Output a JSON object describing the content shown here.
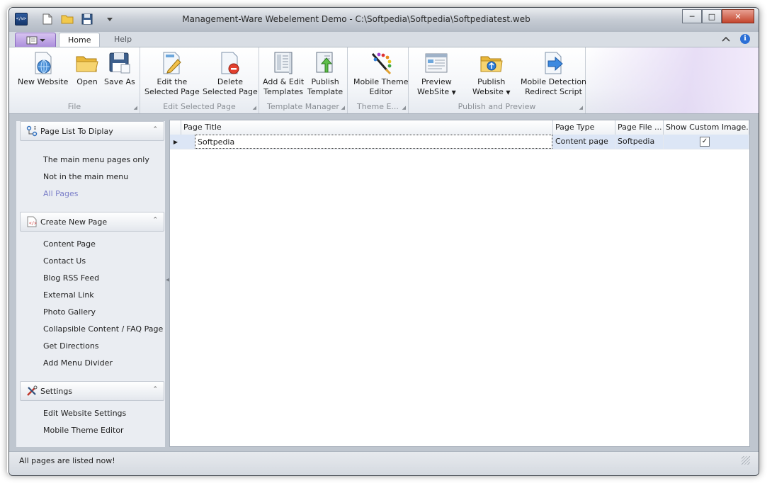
{
  "window": {
    "title": "Management-Ware Webelement Demo - C:\\Softpedia\\Softpedia\\Softpediatest.web",
    "app_icon_text": "</w>"
  },
  "tabs": [
    {
      "label": "Home",
      "active": true
    },
    {
      "label": "Help",
      "active": false
    }
  ],
  "ribbon": {
    "groups": [
      {
        "label": "File",
        "buttons": [
          {
            "line1": "New Website",
            "line2": "",
            "icon": "new-website-icon"
          },
          {
            "line1": "Open",
            "line2": "",
            "icon": "folder-open-icon"
          },
          {
            "line1": "Save As",
            "line2": "",
            "icon": "save-as-icon"
          }
        ]
      },
      {
        "label": "Edit Selected Page",
        "buttons": [
          {
            "line1": "Edit the",
            "line2": "Selected Page",
            "icon": "edit-page-icon"
          },
          {
            "line1": "Delete",
            "line2": "Selected Page",
            "icon": "delete-page-icon"
          }
        ]
      },
      {
        "label": "Template Manager",
        "buttons": [
          {
            "line1": "Add & Edit",
            "line2": "Templates",
            "icon": "templates-icon"
          },
          {
            "line1": "Publish",
            "line2": "Template",
            "icon": "publish-template-icon"
          }
        ]
      },
      {
        "label": "Theme E...",
        "buttons": [
          {
            "line1": "Mobile Theme",
            "line2": "Editor",
            "icon": "theme-editor-icon"
          }
        ]
      },
      {
        "label": "Publish and Preview",
        "buttons": [
          {
            "line1": "Preview",
            "line2": "WebSite",
            "icon": "preview-website-icon",
            "dropdown": true
          },
          {
            "line1": "Publish",
            "line2": "Website",
            "icon": "publish-website-icon",
            "dropdown": true
          },
          {
            "line1": "Mobile Detection",
            "line2": "Redirect Script",
            "icon": "redirect-script-icon"
          }
        ]
      }
    ]
  },
  "left_panel": {
    "sections": [
      {
        "title": "Page List To Diplay",
        "icon": "page-list-icon",
        "items": [
          {
            "label": "The main menu pages only",
            "selected": false
          },
          {
            "label": "Not in the main menu",
            "selected": false
          },
          {
            "label": "All Pages",
            "selected": true
          }
        ]
      },
      {
        "title": "Create New Page",
        "icon": "new-page-icon",
        "items": [
          {
            "label": "Content Page"
          },
          {
            "label": "Contact Us"
          },
          {
            "label": "Blog RSS Feed"
          },
          {
            "label": "External Link"
          },
          {
            "label": "Photo Gallery"
          },
          {
            "label": "Collapsible Content / FAQ Page"
          },
          {
            "label": "Get Directions"
          },
          {
            "label": "Add Menu Divider"
          }
        ]
      },
      {
        "title": "Settings",
        "icon": "settings-tools-icon",
        "items": [
          {
            "label": "Edit Website Settings"
          },
          {
            "label": "Mobile Theme Editor"
          }
        ]
      }
    ]
  },
  "grid": {
    "columns": [
      "Page Title",
      "Page Type",
      "Page File ...",
      "Show Custom Image..."
    ],
    "rows": [
      {
        "title": "Softpedia",
        "type": "Content page",
        "file": "Softpedia",
        "show_custom_image": true
      }
    ]
  },
  "status": {
    "text": "All pages are listed now!"
  },
  "colors": {
    "accent_purple": "#ac8fdc",
    "selection_row": "#dce6f6",
    "nav_selected": "#7b7fc9"
  }
}
